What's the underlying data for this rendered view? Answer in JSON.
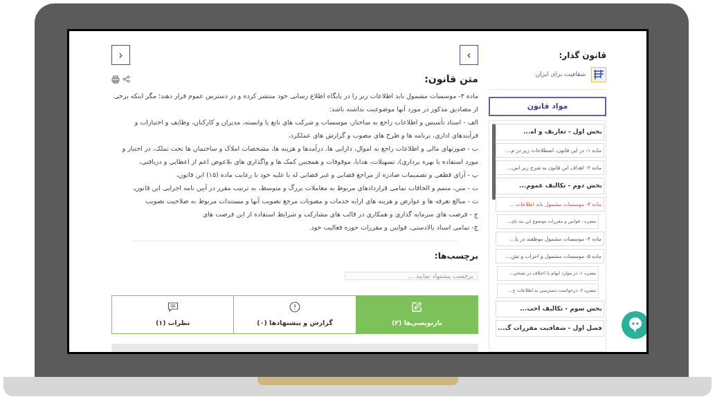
{
  "nav": {
    "prev": "›",
    "next": "‹"
  },
  "main": {
    "title": "متن قانون:",
    "paragraphs": [
      "ماده ۳- موسسات مشمول باید اطلاعات زیر را در پایگاه اطلاع رسانی خود منتشر کرده و در دسترس عموم قرار دهند؛ مگر اینکه برخی از مصادیق مذکور در مورد آنها موضوعیت نداشته باشد:",
      "الف - اسناد تأسیس و اطلاعات راجع به ساختار، موسسات و شرکت های تابع یا وابسته، مدیران و کارکنان، وظایف و اختیارات و فرآیندهای اداری، برنامه ها و طرح های مصوب و گزارش های عملکرد،",
      "ب - صورتهای مالی و اطلاعات راجع به اموال، دارایی ها، درآمدها و هزینه ها، مشخصات املاک و ساختمان ها تحت تملک، در اختیار و مورد استفاده یا بهره برداری)، تسهیلات، هدایا، موقوفات و همچنین کمک ها و واگذاری های بلاعوض اعم از اعطایی و دریافتی،",
      "پ - آرای قطعی و تصمیمات صادره از مراجع قضایی و غیر قضایی له یا علیه خود با رعایت ماده (۱۵) این قانون،",
      "ت - متن، متمم و الحاقات تمامی قراردادهای مربوط به معاملات بزرگ و متوسط، به ترتیب مقرر در آیین نامه اجرایی این قانون،",
      "ث - مبالغ تعرفه ها و عوارض و هزینه های ارایه خدمات و مصوبات مرجع تصویب آنها و مستندات مربوط به صلاحیت تصویب",
      "ج - فرصت های سرمایه گذاری و همکاری در قالب های مشارکت و شرایط استفاده از این فرصت های",
      "چ- تمامی اسناد بالادستی، قوانین و مقررات حوزه فعالیت خود."
    ],
    "tags_title": "برچسب‌ها:",
    "tag_input": {
      "placeholder": "برچسب پیشنهاد نمایید ..."
    },
    "tabs": [
      {
        "kind": "edit",
        "label": "بازنویسی‌ها (۲)",
        "selected": true
      },
      {
        "kind": "alert",
        "label": "گزارش و پیشنهادها (۰)",
        "selected": false
      },
      {
        "kind": "comment",
        "label": "نظرات (۱)",
        "selected": false
      }
    ]
  },
  "sidebar": {
    "title": "قانون گذار:",
    "author": "شفافیت برای ایران",
    "button": "مواد قانون",
    "items": [
      {
        "kind": "section",
        "label": "بخش اول - تعاریف و اه...",
        "selected": false
      },
      {
        "kind": "article",
        "label": "ماده ۱- در این قانون، اصطلاحات زیر در م...",
        "selected": false
      },
      {
        "kind": "article",
        "label": "ماده ۲- اهداف این قانون به شرح زیر اس...",
        "selected": false
      },
      {
        "kind": "section",
        "label": "بخش دوم - تکالیف عموم...",
        "selected": false
      },
      {
        "kind": "article",
        "label": "ماده ۳- موسسات مشمول باید اطلاعات ...",
        "selected": true,
        "children": [
          {
            "label": "تبصره - قوانین و مقررات موضوع این بند باي...",
            "selected": false
          }
        ]
      },
      {
        "kind": "article",
        "label": "ماده ۴- موسسات مشمول موظفند در پا...",
        "selected": false
      },
      {
        "kind": "article",
        "label": "ماده ۵- موسسات مشمول و احزاب و تش...",
        "selected": false,
        "children": [
          {
            "label": "تبصره ۱- در موارد ابهام یا اختلاف در تشخی...",
            "selected": false
          },
          {
            "label": "تبصره ۲- درخواست دسترسی به اطلاعات خ...",
            "selected": false
          }
        ]
      },
      {
        "kind": "section",
        "label": "بخش سوم - تکالیف اخت...",
        "selected": false
      },
      {
        "kind": "section",
        "label": "فصل اول - شفافیت مقررات گ...",
        "selected": false
      }
    ]
  }
}
